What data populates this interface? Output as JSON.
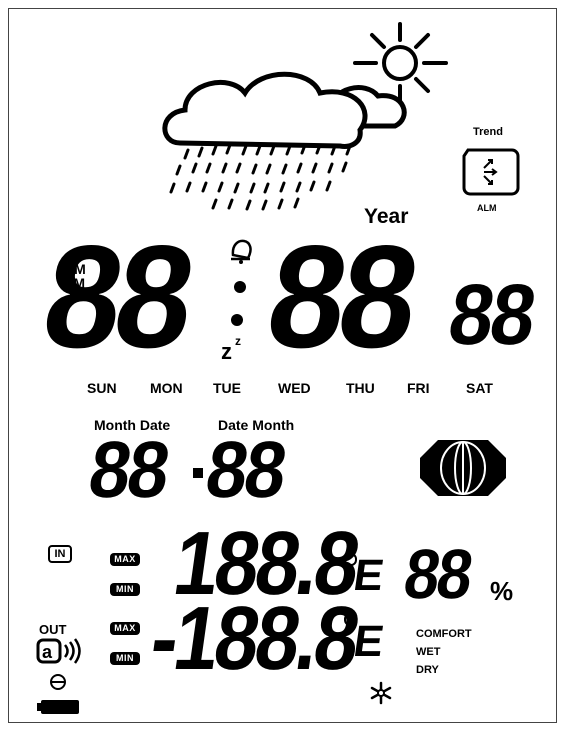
{
  "forecast": {
    "trend_label": "Trend",
    "alarm_label": "ALM"
  },
  "clock": {
    "year_label": "Year",
    "am_label": "AM",
    "pm_label": "PM",
    "hours": "88",
    "minutes": "88",
    "seconds": "88"
  },
  "weekdays": [
    "SUN",
    "MON",
    "TUE",
    "WED",
    "THU",
    "FRI",
    "SAT"
  ],
  "date": {
    "label_left": "Month Date",
    "label_right": "Date Month",
    "left": "88",
    "right": "88"
  },
  "indoor": {
    "in_label": "IN",
    "max_label": "MAX",
    "min_label": "MIN",
    "temperature": "188.8",
    "unit": "E",
    "humidity": "88",
    "humidity_unit": "%"
  },
  "outdoor": {
    "out_label": "OUT",
    "max_label": "MAX",
    "min_label": "MIN",
    "temperature": "-188.8",
    "unit": "E",
    "comfort_label": "COMFORT",
    "wet_label": "WET",
    "dry_label": "DRY"
  },
  "icons": [
    "cloud-icon",
    "sun-icon",
    "rain-icon",
    "trend-icon",
    "alarm-bell-icon",
    "snooze-icon",
    "moon-phase-icon",
    "wireless-signal-icon",
    "rf-sync-icon",
    "battery-icon",
    "snowflake-icon"
  ]
}
